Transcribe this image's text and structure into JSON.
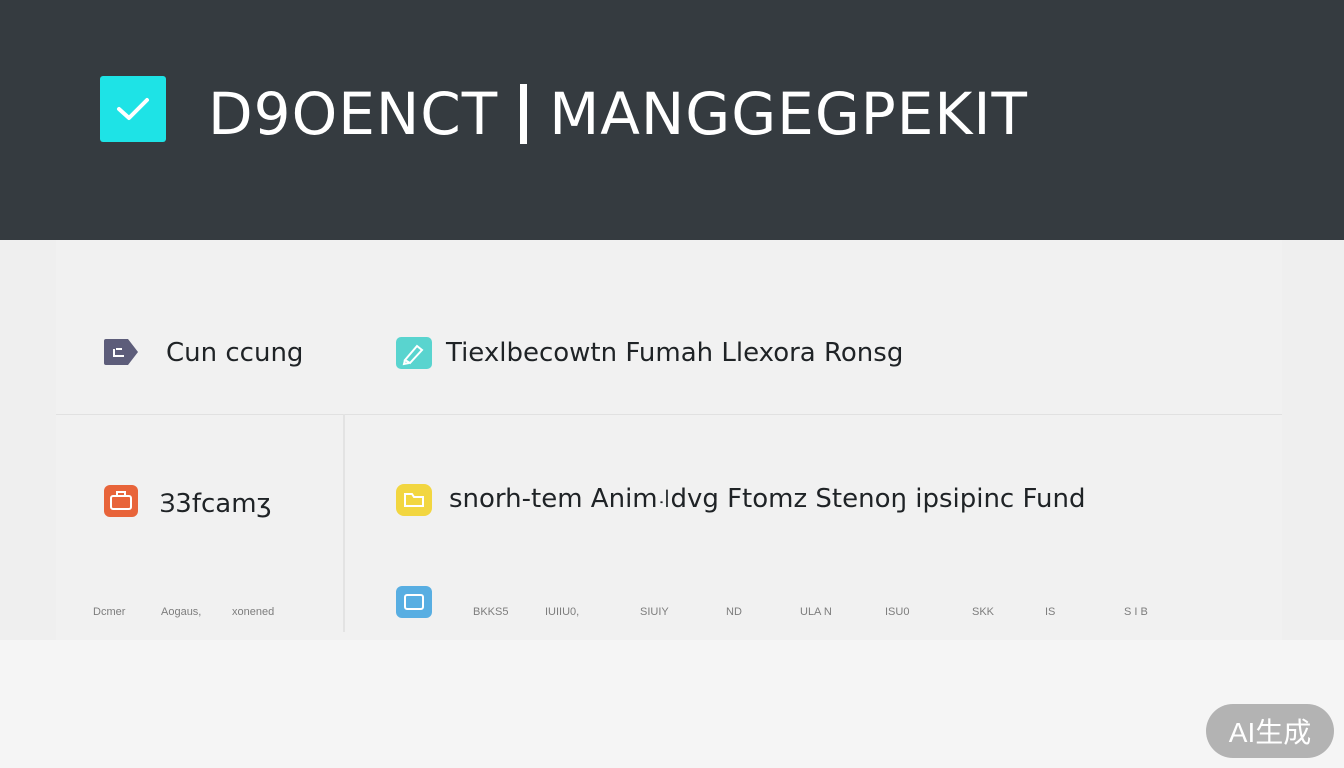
{
  "header": {
    "title_left": "ꓓ9OENCT",
    "title_right": "MANGGEGPEKIT",
    "accent": "#1ee3e6",
    "background": "#353b40"
  },
  "rows": [
    {
      "icon": "tag-icon",
      "icon_color": "#5d5d7a",
      "label": "Cun ccung"
    },
    {
      "icon": "edit-icon",
      "icon_color": "#59d4cf",
      "label": "Tiexlbecowtn Fumah Llexora Ronsg"
    },
    {
      "icon": "briefcase-icon",
      "icon_color": "#e8643a",
      "label": "Ɜ3fcamʒ"
    },
    {
      "icon": "folder-icon",
      "icon_color": "#f2d640",
      "label": "snorh-tem Anim꜋dvg Ftomz Stenoŋ ipsipinc Fund"
    },
    {
      "icon": "file-icon",
      "icon_color": "#58aee2"
    }
  ],
  "left_labels": [
    "Dcmer",
    "Aogaus,",
    "xonened"
  ],
  "right_labels": [
    "BKKS5",
    "IUIIU0,",
    "SIUIY",
    "ND",
    "ULA N",
    "ISU0",
    "SKK",
    "IS",
    "S I B"
  ],
  "badge": {
    "label": "AI生成"
  }
}
